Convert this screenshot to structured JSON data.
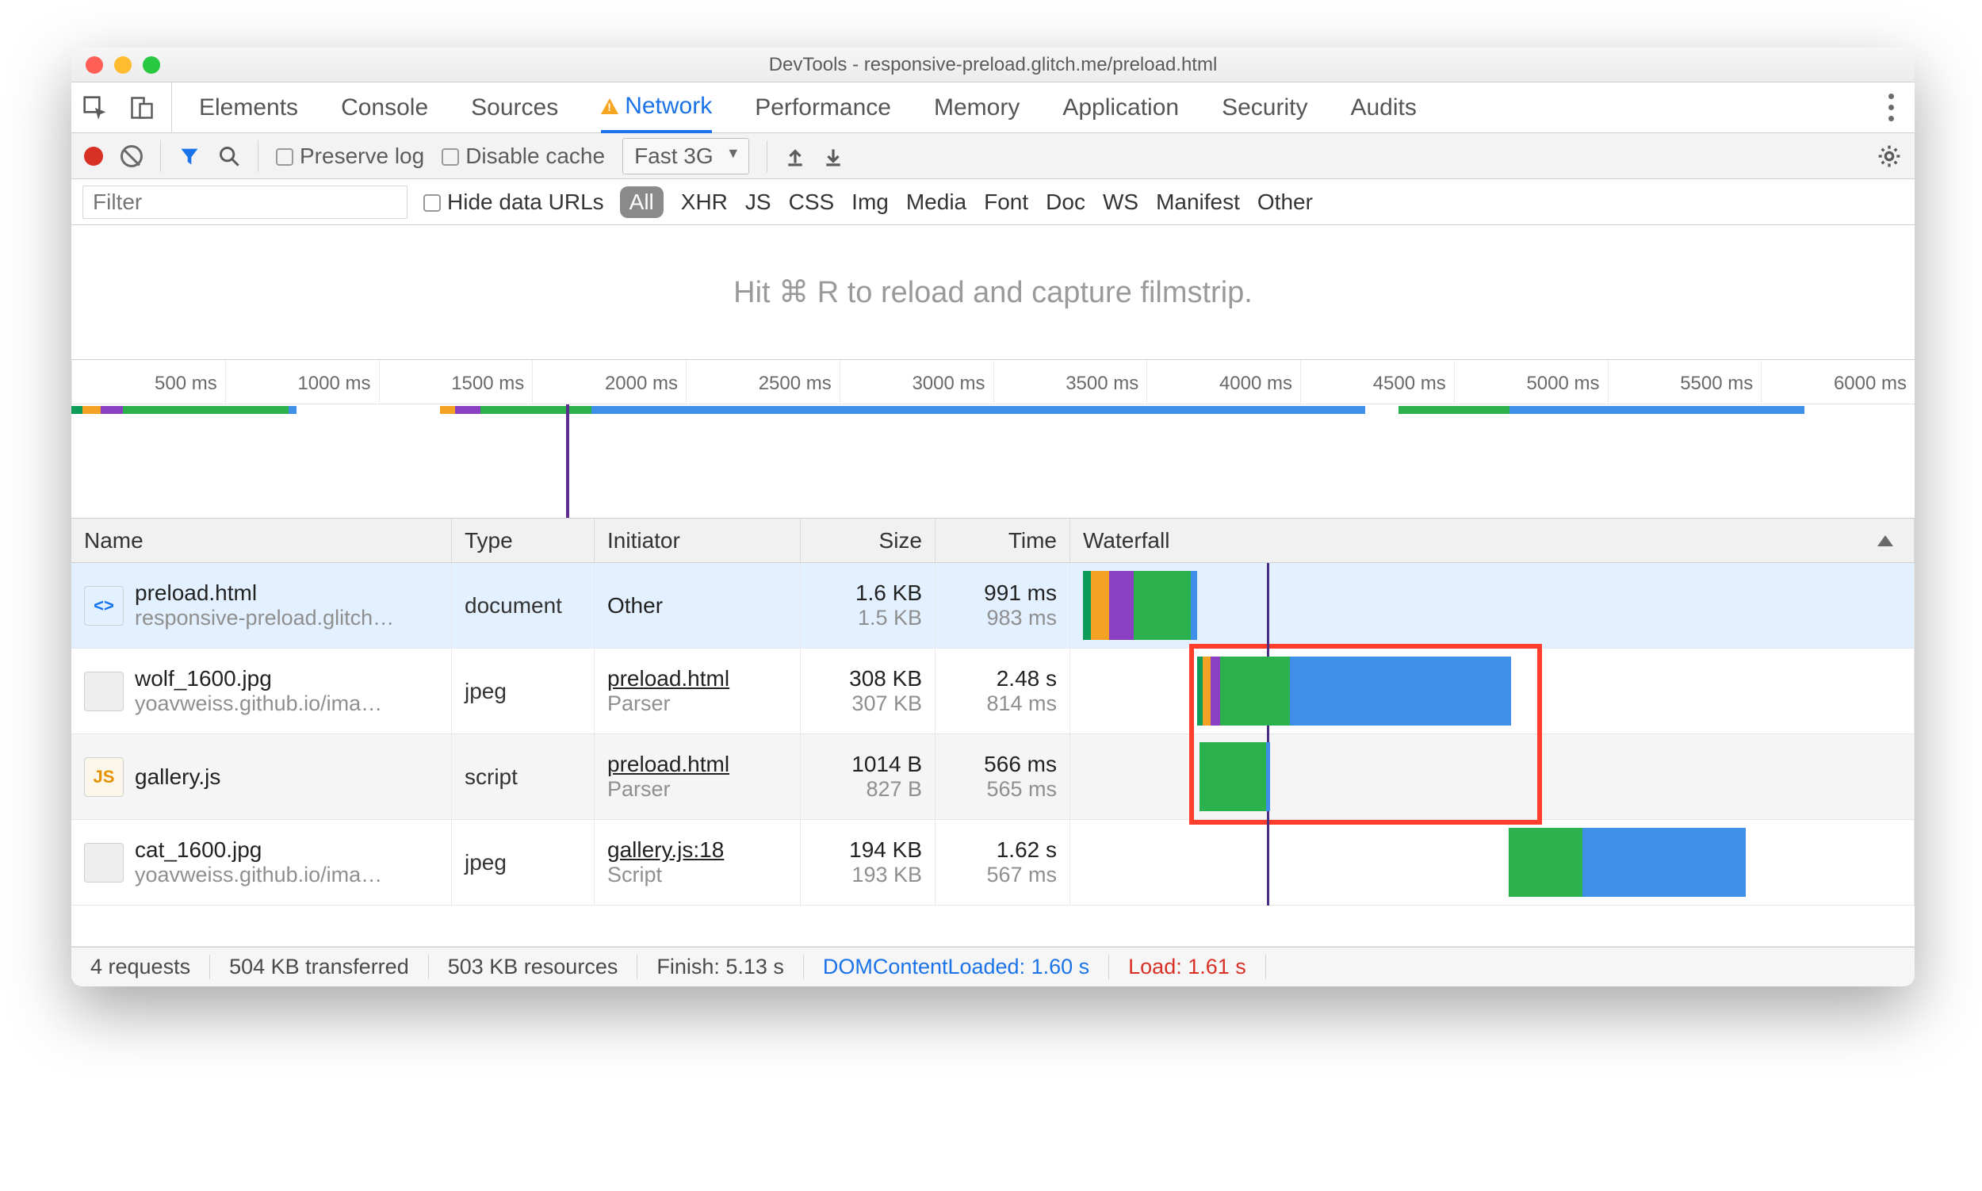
{
  "window": {
    "title": "DevTools - responsive-preload.glitch.me/preload.html"
  },
  "tabs": {
    "items": [
      "Elements",
      "Console",
      "Sources",
      "Network",
      "Performance",
      "Memory",
      "Application",
      "Security",
      "Audits"
    ],
    "active": "Network",
    "warn_on": "Network"
  },
  "toolbar": {
    "preserve_log": "Preserve log",
    "disable_cache": "Disable cache",
    "throttling": "Fast 3G"
  },
  "filterbar": {
    "placeholder": "Filter",
    "hide_data_urls": "Hide data URLs",
    "types": [
      "All",
      "XHR",
      "JS",
      "CSS",
      "Img",
      "Media",
      "Font",
      "Doc",
      "WS",
      "Manifest",
      "Other"
    ],
    "active_type": "All"
  },
  "filmstrip_hint": "Hit ⌘ R to reload and capture filmstrip.",
  "timeline": {
    "ticks": [
      "500 ms",
      "1000 ms",
      "1500 ms",
      "2000 ms",
      "2500 ms",
      "3000 ms",
      "3500 ms",
      "4000 ms",
      "4500 ms",
      "5000 ms",
      "5500 ms",
      "6000 ms"
    ],
    "playhead_ms": 1610
  },
  "columns": {
    "name": "Name",
    "type": "Type",
    "initiator": "Initiator",
    "size": "Size",
    "time": "Time",
    "waterfall": "Waterfall"
  },
  "requests": [
    {
      "name": "preload.html",
      "sub": "responsive-preload.glitch…",
      "type": "document",
      "initiator": "Other",
      "initiator_sub": "",
      "size": "1.6 KB",
      "size_sub": "1.5 KB",
      "time": "991 ms",
      "time_sub": "983 ms",
      "icon": "html",
      "wf": [
        {
          "class": "s-dns",
          "l": 0,
          "w": 1.0
        },
        {
          "class": "s-con",
          "l": 1.0,
          "w": 2.2
        },
        {
          "class": "s-ssl",
          "l": 3.2,
          "w": 3.0
        },
        {
          "class": "s-wait",
          "l": 6.2,
          "w": 7.0
        },
        {
          "class": "s-dl",
          "l": 13.2,
          "w": 0.8
        }
      ]
    },
    {
      "name": "wolf_1600.jpg",
      "sub": "yoavweiss.github.io/ima…",
      "type": "jpeg",
      "initiator": "preload.html",
      "initiator_sub": "Parser",
      "size": "308 KB",
      "size_sub": "307 KB",
      "time": "2.48 s",
      "time_sub": "814 ms",
      "icon": "img",
      "wf": [
        {
          "class": "s-dns",
          "l": 14.0,
          "w": 0.6
        },
        {
          "class": "s-con",
          "l": 14.6,
          "w": 1.0
        },
        {
          "class": "s-ssl",
          "l": 15.6,
          "w": 1.2
        },
        {
          "class": "s-wait",
          "l": 16.8,
          "w": 8.5
        },
        {
          "class": "s-dl",
          "l": 25.3,
          "w": 27.0
        }
      ]
    },
    {
      "name": "gallery.js",
      "sub": "",
      "type": "script",
      "initiator": "preload.html",
      "initiator_sub": "Parser",
      "size": "1014 B",
      "size_sub": "827 B",
      "time": "566 ms",
      "time_sub": "565 ms",
      "icon": "js",
      "wf": [
        {
          "class": "s-wait",
          "l": 14.2,
          "w": 8.2
        },
        {
          "class": "s-dl",
          "l": 22.4,
          "w": 0.5
        }
      ]
    },
    {
      "name": "cat_1600.jpg",
      "sub": "yoavweiss.github.io/ima…",
      "type": "jpeg",
      "initiator": "gallery.js:18",
      "initiator_sub": "Script",
      "size": "194 KB",
      "size_sub": "193 KB",
      "time": "1.62 s",
      "time_sub": "567 ms",
      "icon": "img",
      "wf": [
        {
          "class": "s-wait",
          "l": 52.0,
          "w": 9.0
        },
        {
          "class": "s-dl",
          "l": 61.0,
          "w": 20.0
        }
      ]
    }
  ],
  "highlight": {
    "row_start": 1,
    "row_end": 2,
    "left_pct": 13.6,
    "right_pct": 55.5
  },
  "status": {
    "requests": "4 requests",
    "transferred": "504 KB transferred",
    "resources": "503 KB resources",
    "finish": "Finish: 5.13 s",
    "dcl": "DOMContentLoaded: 1.60 s",
    "load": "Load: 1.61 s"
  }
}
